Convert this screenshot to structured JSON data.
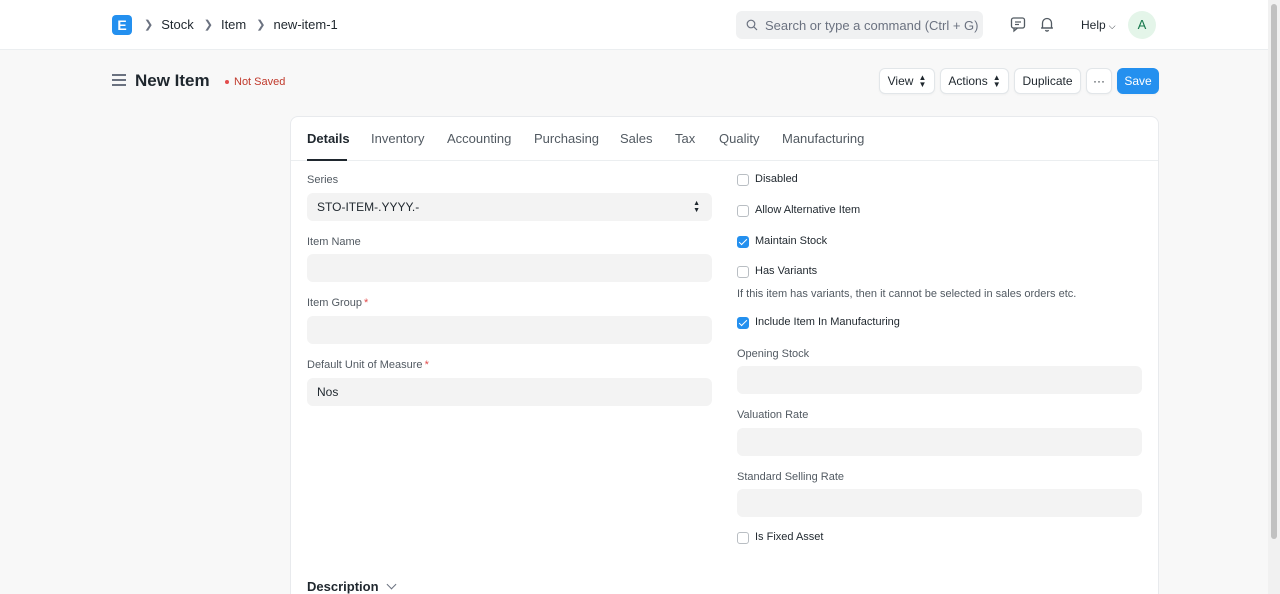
{
  "navbar": {
    "logo_letter": "E",
    "breadcrumbs": [
      "Stock",
      "Item",
      "new-item-1"
    ],
    "search_placeholder": "Search or type a command (Ctrl + G)",
    "help_label": "Help",
    "avatar_initial": "A"
  },
  "page": {
    "title": "New Item",
    "status": "Not Saved",
    "buttons": {
      "view": "View",
      "actions": "Actions",
      "duplicate": "Duplicate",
      "more": "···",
      "save": "Save"
    }
  },
  "tabs": [
    "Details",
    "Inventory",
    "Accounting",
    "Purchasing",
    "Sales",
    "Tax",
    "Quality",
    "Manufacturing"
  ],
  "active_tab": "Details",
  "left_fields": {
    "series": {
      "label": "Series",
      "value": "STO-ITEM-.YYYY.-"
    },
    "item_name": {
      "label": "Item Name",
      "value": ""
    },
    "item_group": {
      "label": "Item Group",
      "required": "*",
      "value": ""
    },
    "uom": {
      "label": "Default Unit of Measure",
      "required": "*",
      "value": "Nos"
    }
  },
  "right_fields": {
    "disabled": {
      "label": "Disabled",
      "checked": false
    },
    "allow_alternative": {
      "label": "Allow Alternative Item",
      "checked": false
    },
    "maintain_stock": {
      "label": "Maintain Stock",
      "checked": true
    },
    "has_variants": {
      "label": "Has Variants",
      "checked": false
    },
    "variants_help": "If this item has variants, then it cannot be selected in sales orders etc.",
    "include_manufacturing": {
      "label": "Include Item In Manufacturing",
      "checked": true
    },
    "opening_stock": {
      "label": "Opening Stock",
      "value": ""
    },
    "valuation_rate": {
      "label": "Valuation Rate",
      "value": ""
    },
    "standard_selling_rate": {
      "label": "Standard Selling Rate",
      "value": ""
    },
    "is_fixed_asset": {
      "label": "Is Fixed Asset",
      "checked": false
    }
  },
  "sections": {
    "description": "Description"
  },
  "colors": {
    "primary": "#2490ef",
    "not_saved": "#c0392b",
    "required": "#e24c4c"
  }
}
